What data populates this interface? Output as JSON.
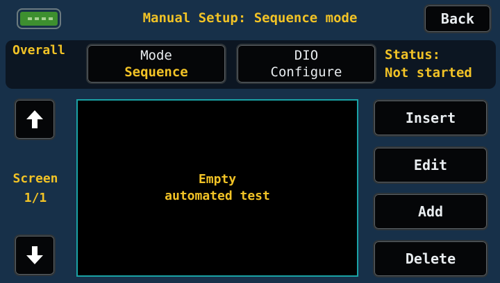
{
  "header": {
    "title": "Manual Setup: Sequence mode",
    "back_label": "Back",
    "battery_icon": "battery-icon"
  },
  "overall": {
    "label": "Overall",
    "mode": {
      "label": "Mode",
      "value": "Sequence"
    },
    "dio": {
      "label": "DIO",
      "value": "Configure"
    },
    "status": {
      "label": "Status:",
      "value": "Not started"
    }
  },
  "nav": {
    "up_icon": "arrow-up-icon",
    "down_icon": "arrow-down-icon",
    "screen_label": "Screen",
    "screen_value": "1/1"
  },
  "viewport": {
    "line1": "Empty",
    "line2": "automated test"
  },
  "actions": {
    "insert": "Insert",
    "edit": "Edit",
    "add": "Add",
    "delete": "Delete"
  },
  "colors": {
    "background": "#173049",
    "accent": "#f2c326",
    "panel": "#0c1622",
    "viewport_border": "#1aa3a6",
    "battery": "#3d8f2f"
  }
}
